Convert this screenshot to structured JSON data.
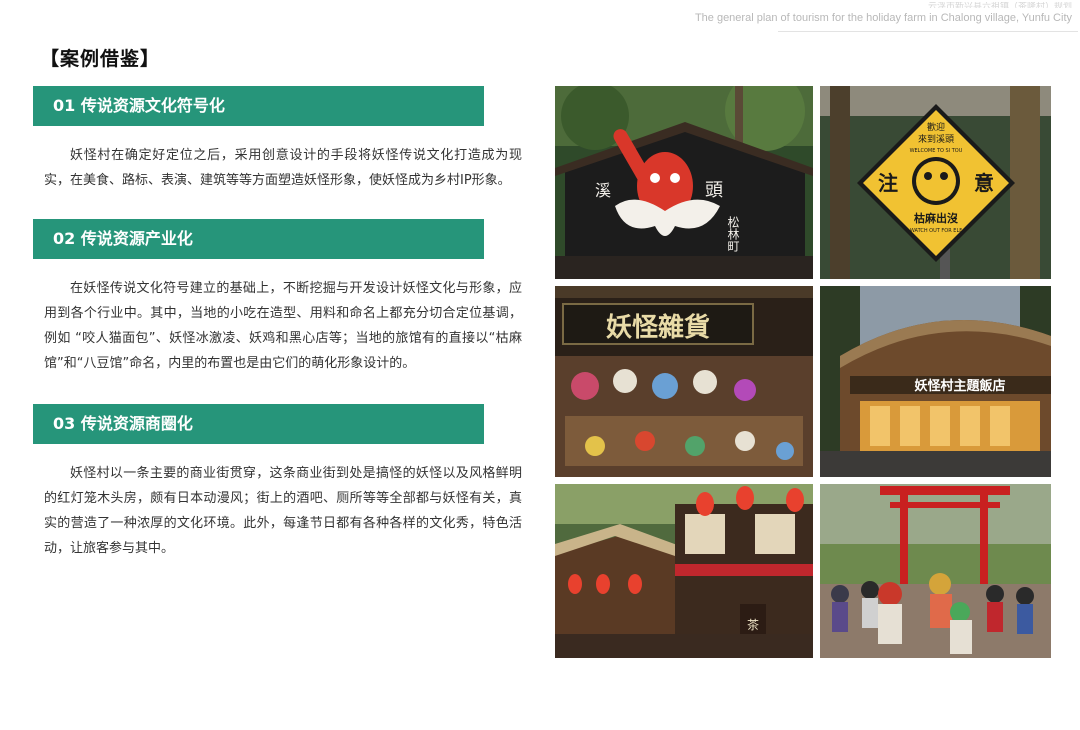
{
  "header": {
    "faded_text": "云浮市新兴县六祖镇（茶隆村）规划",
    "subtitle": "The general plan of tourism for the holiday farm in Chalong village, Yunfu City"
  },
  "page_title": "【案例借鉴】",
  "sections": [
    {
      "heading": "01 传说资源文化符号化",
      "body": "妖怪村在确定好定位之后，采用创意设计的手段将妖怪传说文化打造成为现实，在美食、路标、表演、建筑等等方面塑造妖怪形象，使妖怪成为乡村IP形象。"
    },
    {
      "heading": "02 传说资源产业化",
      "body": "在妖怪传说文化符号建立的基础上，不断挖掘与开发设计妖怪文化与形象，应用到各个行业中。其中，当地的小吃在造型、用料和命名上都充分切合定位基调，例如 “咬人猫面包”、妖怪冰激凌、妖鸡和黑心店等；当地的旅馆有的直接以“枯麻馆”和“八豆馆”命名，内里的布置也是由它们的萌化形象设计的。"
    },
    {
      "heading": "03 传说资源商圈化",
      "body": "妖怪村以一条主要的商业街贯穿，这条商业街到处是搞怪的妖怪以及风格鲜明的红灯笼木头房，颇有日本动漫风；街上的酒吧、厕所等等全部都与妖怪有关，真实的营造了一种浓厚的文化环境。此外，每逢节日都有各种各样的文化秀，特色活动，让旅客参与其中。"
    }
  ],
  "photos": {
    "p1": {
      "sign_left": "溪",
      "sign_right": "頭",
      "sign_vertical": "松林町"
    },
    "p2": {
      "top": "歡迎",
      "top2": "來到溪頭",
      "banner": "WELCOME TO SI TOU",
      "left": "注",
      "right": "意",
      "bottom": "枯麻出沒",
      "small": "WATCH OUT FOR ELF"
    },
    "p3": {
      "sign": "妖怪雜貨"
    },
    "p4": {
      "sign": "妖怪村主題飯店"
    },
    "p5": {
      "lantern": "茶"
    },
    "p6": {}
  },
  "colors": {
    "accent": "#26957a",
    "title": "#111111",
    "body_text": "#333333"
  }
}
